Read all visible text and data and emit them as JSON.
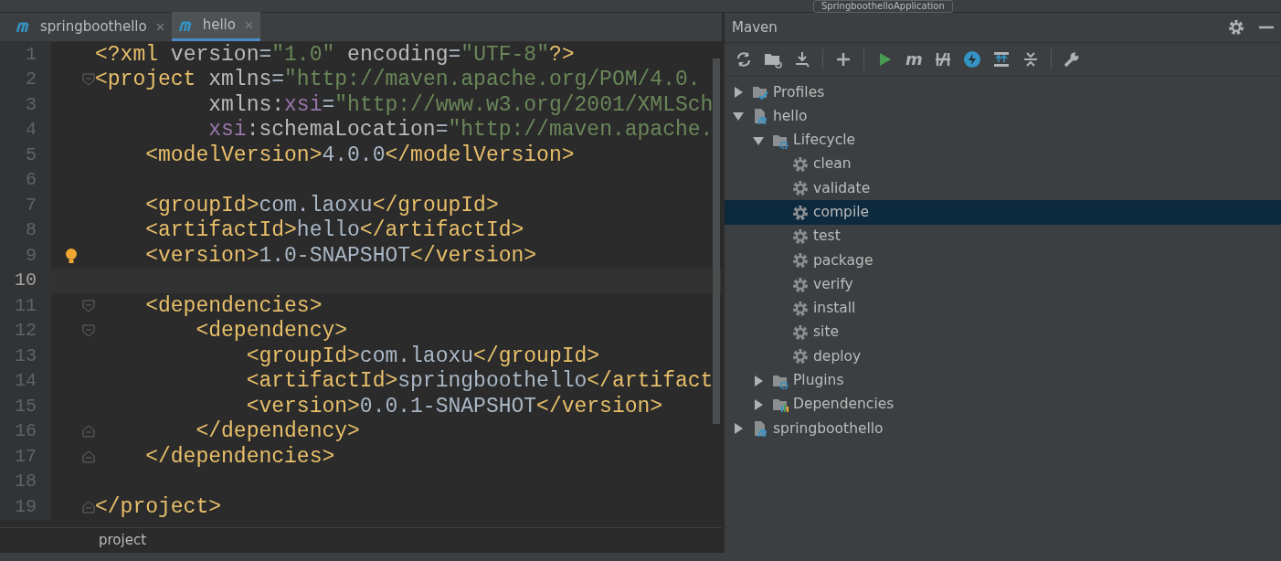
{
  "toolbar": {
    "run_config": "SpringboothelloApplication"
  },
  "tabs": [
    {
      "label": "springboothello",
      "selected": false
    },
    {
      "label": "hello",
      "selected": true
    }
  ],
  "editor": {
    "lines": [
      {
        "number": "1",
        "segments": [
          {
            "kind": "tag",
            "text": "<?xml "
          },
          {
            "kind": "attr",
            "text": "version"
          },
          {
            "kind": "text",
            "text": "="
          },
          {
            "kind": "string",
            "text": "\"1.0\""
          },
          {
            "kind": "attr",
            "text": " encoding"
          },
          {
            "kind": "text",
            "text": "="
          },
          {
            "kind": "string",
            "text": "\"UTF-8\""
          },
          {
            "kind": "tag",
            "text": "?>"
          }
        ]
      },
      {
        "number": "2",
        "fold_open": true,
        "segments": [
          {
            "kind": "tag",
            "text": "<project "
          },
          {
            "kind": "attr",
            "text": "xmlns"
          },
          {
            "kind": "text",
            "text": "="
          },
          {
            "kind": "string",
            "text": "\"http://maven.apache.org/POM/4.0."
          }
        ]
      },
      {
        "number": "3",
        "segments": [
          {
            "kind": "attr",
            "text": "         xmlns:"
          },
          {
            "kind": "ns",
            "text": "xsi"
          },
          {
            "kind": "text",
            "text": "="
          },
          {
            "kind": "string",
            "text": "\"http://www.w3.org/2001/XMLSch"
          }
        ]
      },
      {
        "number": "4",
        "segments": [
          {
            "kind": "ns",
            "text": "         xsi"
          },
          {
            "kind": "attr",
            "text": ":schemaLocation"
          },
          {
            "kind": "text",
            "text": "="
          },
          {
            "kind": "string",
            "text": "\"http://maven.apache."
          }
        ]
      },
      {
        "number": "5",
        "segments": [
          {
            "kind": "tag",
            "text": "    <modelVersion>"
          },
          {
            "kind": "text",
            "text": "4.0.0"
          },
          {
            "kind": "tag",
            "text": "</modelVersion>"
          }
        ]
      },
      {
        "number": "6"
      },
      {
        "number": "7",
        "segments": [
          {
            "kind": "tag",
            "text": "    <groupId>"
          },
          {
            "kind": "text",
            "text": "com.laoxu"
          },
          {
            "kind": "tag",
            "text": "</groupId>"
          }
        ]
      },
      {
        "number": "8",
        "segments": [
          {
            "kind": "tag",
            "text": "    <artifactId>"
          },
          {
            "kind": "text",
            "text": "hello"
          },
          {
            "kind": "tag",
            "text": "</artifactId>"
          }
        ]
      },
      {
        "number": "9",
        "bulb": true,
        "segments": [
          {
            "kind": "tag",
            "text": "    <version>"
          },
          {
            "kind": "text",
            "text": "1.0-SNAPSHOT"
          },
          {
            "kind": "tag",
            "text": "</version>"
          }
        ]
      },
      {
        "number": "10",
        "current": true
      },
      {
        "number": "11",
        "fold_open": true,
        "segments": [
          {
            "kind": "tag",
            "text": "    <dependencies>"
          }
        ]
      },
      {
        "number": "12",
        "fold_open": true,
        "segments": [
          {
            "kind": "tag",
            "text": "        <dependency>"
          }
        ]
      },
      {
        "number": "13",
        "segments": [
          {
            "kind": "tag",
            "text": "            <groupId>"
          },
          {
            "kind": "text",
            "text": "com.laoxu"
          },
          {
            "kind": "tag",
            "text": "</groupId>"
          }
        ]
      },
      {
        "number": "14",
        "segments": [
          {
            "kind": "tag",
            "text": "            <artifactId>"
          },
          {
            "kind": "text",
            "text": "springboothello"
          },
          {
            "kind": "tag",
            "text": "</artifact"
          }
        ]
      },
      {
        "number": "15",
        "segments": [
          {
            "kind": "tag",
            "text": "            <version>"
          },
          {
            "kind": "text",
            "text": "0.0.1-SNAPSHOT"
          },
          {
            "kind": "tag",
            "text": "</version>"
          }
        ]
      },
      {
        "number": "16",
        "fold_close": true,
        "segments": [
          {
            "kind": "tag",
            "text": "        </dependency>"
          }
        ]
      },
      {
        "number": "17",
        "fold_close": true,
        "segments": [
          {
            "kind": "tag",
            "text": "    </dependencies>"
          }
        ]
      },
      {
        "number": "18"
      },
      {
        "number": "19",
        "fold_close": true,
        "segments": [
          {
            "kind": "tag",
            "text": "</project>"
          }
        ]
      }
    ]
  },
  "breadcrumb": "project",
  "maven": {
    "title": "Maven",
    "tools": [
      {
        "kind": "refresh"
      },
      {
        "kind": "folder-refresh"
      },
      {
        "kind": "download"
      },
      {
        "kind": "sep"
      },
      {
        "kind": "plus"
      },
      {
        "kind": "sep"
      },
      {
        "kind": "run"
      },
      {
        "kind": "m"
      },
      {
        "kind": "skip"
      },
      {
        "kind": "bolt"
      },
      {
        "kind": "expand"
      },
      {
        "kind": "collapse"
      },
      {
        "kind": "sep"
      },
      {
        "kind": "wrench"
      }
    ],
    "tree": [
      {
        "label": "Profiles",
        "kind": "profiles",
        "expanded": false,
        "selected": false
      },
      {
        "label": "hello",
        "kind": "module",
        "expanded": true,
        "selected": false,
        "children": [
          {
            "label": "Lifecycle",
            "kind": "lifecycle",
            "expanded": true,
            "selected": false,
            "children": [
              {
                "label": "clean",
                "kind": "goal",
                "selected": false
              },
              {
                "label": "validate",
                "kind": "goal",
                "selected": false
              },
              {
                "label": "compile",
                "kind": "goal",
                "selected": true
              },
              {
                "label": "test",
                "kind": "goal",
                "selected": false
              },
              {
                "label": "package",
                "kind": "goal",
                "selected": false
              },
              {
                "label": "verify",
                "kind": "goal",
                "selected": false
              },
              {
                "label": "install",
                "kind": "goal",
                "selected": false
              },
              {
                "label": "site",
                "kind": "goal",
                "selected": false
              },
              {
                "label": "deploy",
                "kind": "goal",
                "selected": false
              }
            ]
          },
          {
            "label": "Plugins",
            "kind": "lifecycle",
            "expanded": false,
            "selected": false
          },
          {
            "label": "Dependencies",
            "kind": "dependencies",
            "expanded": false,
            "selected": false
          }
        ]
      },
      {
        "label": "springboothello",
        "kind": "module",
        "expanded": false,
        "selected": false
      }
    ]
  }
}
